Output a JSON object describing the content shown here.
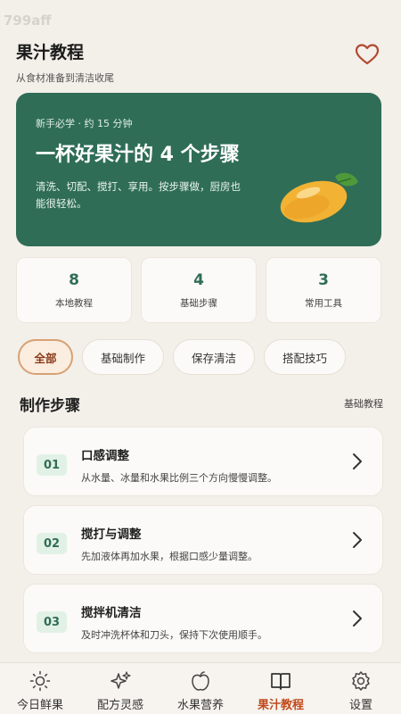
{
  "watermark": "799aff",
  "header": {
    "title": "果汁教程",
    "subtitle": "从食材准备到清洁收尾"
  },
  "hero": {
    "tag": "新手必学 · 约 15 分钟",
    "title": "一杯好果汁的 4 个步骤",
    "desc": "清洗、切配、搅打、享用。按步骤做，厨房也能很轻松。"
  },
  "stats": [
    {
      "num": "8",
      "label": "本地教程"
    },
    {
      "num": "4",
      "label": "基础步骤"
    },
    {
      "num": "3",
      "label": "常用工具"
    }
  ],
  "chips": [
    "全部",
    "基础制作",
    "保存清洁",
    "搭配技巧"
  ],
  "section": {
    "title": "制作步骤",
    "link": "基础教程"
  },
  "steps": [
    {
      "num": "01",
      "title": "口感调整",
      "desc": "从水量、冰量和水果比例三个方向慢慢调整。"
    },
    {
      "num": "02",
      "title": "搅打与调整",
      "desc": "先加液体再加水果，根据口感少量调整。"
    },
    {
      "num": "03",
      "title": "搅拌机清洁",
      "desc": "及时冲洗杯体和刀头，保持下次使用顺手。"
    }
  ],
  "tabs": [
    {
      "label": "今日鲜果",
      "icon": "sun-icon"
    },
    {
      "label": "配方灵感",
      "icon": "sparkle-icon"
    },
    {
      "label": "水果营养",
      "icon": "apple-icon"
    },
    {
      "label": "果汁教程",
      "icon": "book-icon"
    },
    {
      "label": "设置",
      "icon": "gear-icon"
    }
  ],
  "colors": {
    "background": "#f3efe9",
    "primary_green": "#2f6d57",
    "accent": "#c04a1e"
  }
}
